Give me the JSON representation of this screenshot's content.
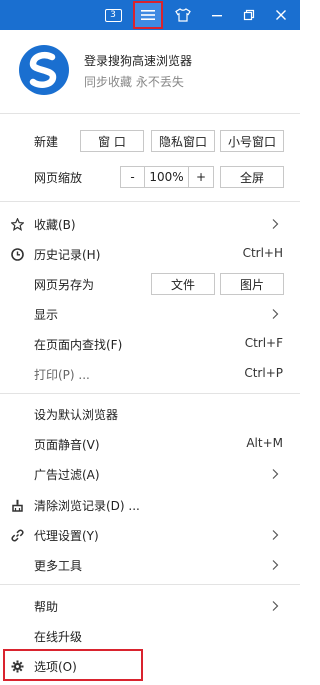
{
  "titlebar": {
    "tab_count": "3",
    "accent": "#1a6fd0",
    "highlight": "#d9232e"
  },
  "login": {
    "title": "登录搜狗高速浏览器",
    "subtitle": "同步收藏 永不丢失"
  },
  "new_row": {
    "label": "新建",
    "window": "窗 口",
    "private_window": "隐私窗口",
    "small_window": "小号窗口"
  },
  "zoom_row": {
    "label": "网页缩放",
    "minus": "-",
    "value": "100%",
    "plus": "+",
    "fullscreen": "全屏"
  },
  "menu": {
    "favorites": "收藏(B)",
    "history": "历史记录(H)",
    "history_shortcut": "Ctrl+H",
    "save_as": "网页另存为",
    "save_file": "文件",
    "save_image": "图片",
    "display": "显示",
    "find": "在页面内查找(F)",
    "find_shortcut": "Ctrl+F",
    "print": "打印(P) ...",
    "print_shortcut": "Ctrl+P",
    "set_default": "设为默认浏览器",
    "mute": "页面静音(V)",
    "mute_shortcut": "Alt+M",
    "ad_filter": "广告过滤(A)",
    "clear_history": "清除浏览记录(D) ...",
    "proxy": "代理设置(Y)",
    "more_tools": "更多工具",
    "help": "帮助",
    "upgrade": "在线升级",
    "options": "选项(O)"
  }
}
